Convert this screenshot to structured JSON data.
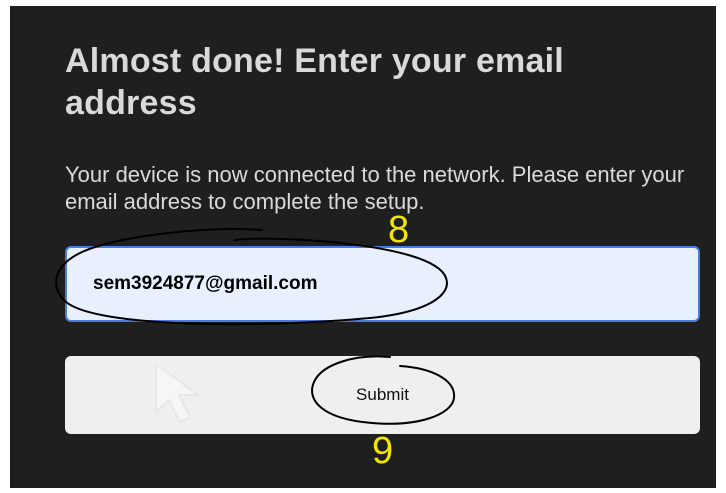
{
  "heading": "Almost done! Enter your email address",
  "description": "Your device is now connected to the network. Please enter your email address to complete the setup.",
  "email_field": {
    "value": "sem3924877@gmail.com"
  },
  "submit_button": {
    "label": "Submit"
  },
  "annotations": {
    "step_email": "8",
    "step_submit": "9",
    "color": "#f2e600"
  },
  "colors": {
    "background": "#1f1f1f",
    "input_background": "#e8f0fe",
    "input_border": "#4a7ce0",
    "button_background": "#efefef",
    "text": "#dadada"
  }
}
